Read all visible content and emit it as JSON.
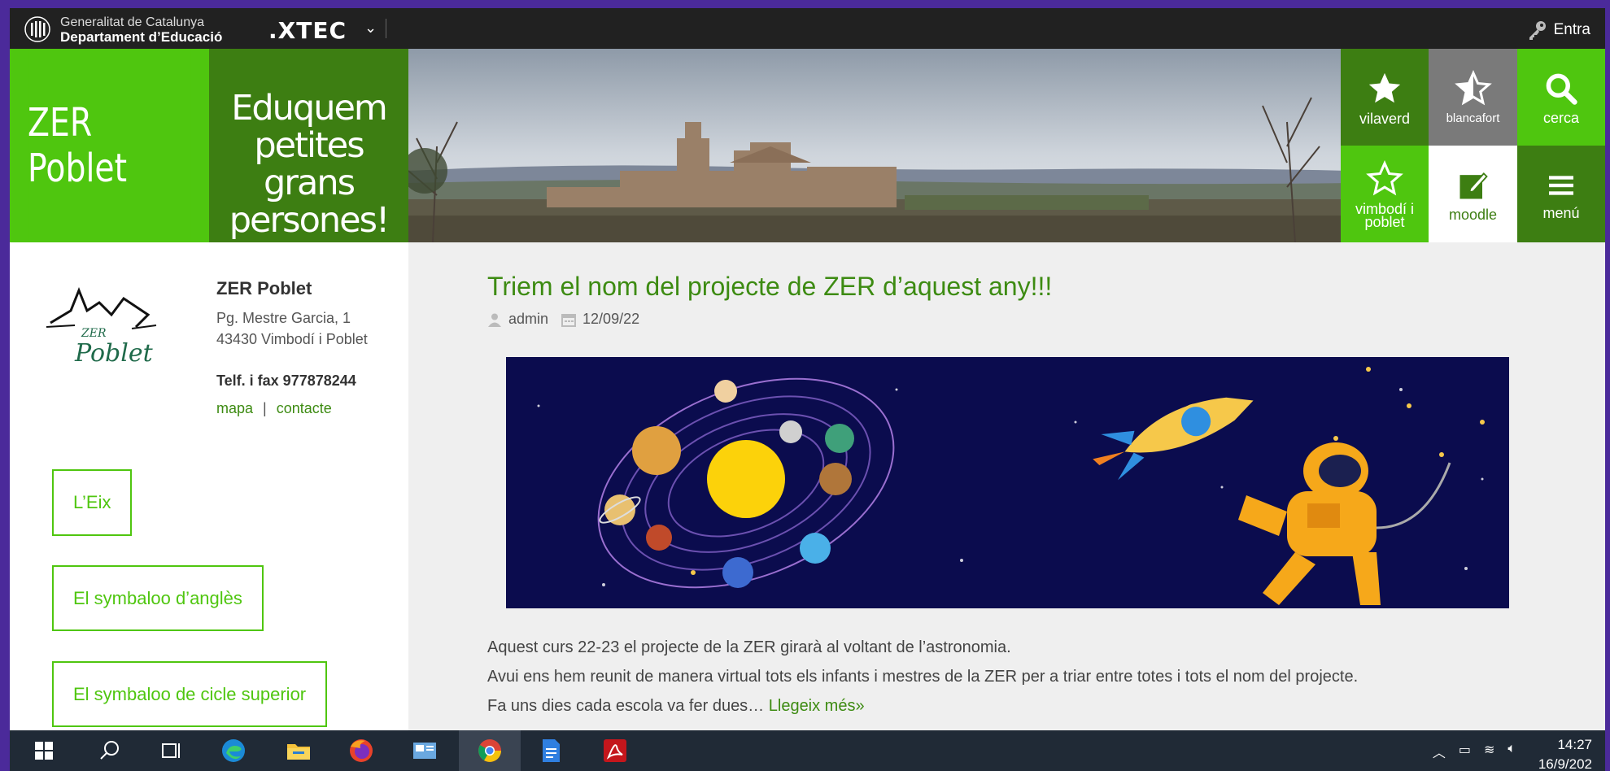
{
  "topbar": {
    "gov_line1": "Generalitat de Catalunya",
    "gov_line2": "Departament d’Educació",
    "xtec": ".XTEC",
    "login": "Entra"
  },
  "header": {
    "brand": "ZER Poblet",
    "slogan": "Eduquem petites grans persones!",
    "tiles": [
      {
        "label": "vilaverd",
        "icon": "star-filled-icon",
        "color": "#3d7e12"
      },
      {
        "label": "blancafort",
        "icon": "star-half-icon",
        "color": "#7a7a7a"
      },
      {
        "label": "cerca",
        "icon": "search-icon",
        "color": "#4fc60f"
      },
      {
        "label": "vimbodí i poblet",
        "icon": "star-outline-icon",
        "color": "#4fc60f"
      },
      {
        "label": "moodle",
        "icon": "edit-icon",
        "color": "#ffffff"
      },
      {
        "label": "menú",
        "icon": "menu-icon",
        "color": "#3d7e12"
      }
    ]
  },
  "sidebar": {
    "logo_text_1": "ZER",
    "logo_text_2": "Poblet",
    "school_name": "ZER Poblet",
    "address": "Pg. Mestre Garcia, 1 43430 Vimbodí i Poblet",
    "phone": "Telf. i fax 977878244",
    "link_map": "mapa",
    "link_sep": "|",
    "link_contact": "contacte",
    "buttons": [
      "L’Eix",
      "El symbaloo d’anglès",
      "El symbaloo de cicle superior"
    ]
  },
  "post": {
    "title": "Triem el nom del projecte de ZER d’aquest any!!!",
    "author": "admin",
    "date": "12/09/22",
    "line1": "Aquest curs 22-23 el projecte de la ZER girarà al voltant de l’astronomia.",
    "line2": "Avui ens hem reunit de manera virtual tots els infants i mestres de la ZER per a triar entre totes i tots el nom del projecte.",
    "line3": "Fa uns dies cada escola va fer dues…",
    "more": "Llegeix més»"
  },
  "taskbar": {
    "time": "14:27",
    "date": "16/9/202"
  },
  "colors": {
    "green_bright": "#4fc60f",
    "green_dark": "#3d7e12",
    "link_green": "#3d8b12"
  }
}
